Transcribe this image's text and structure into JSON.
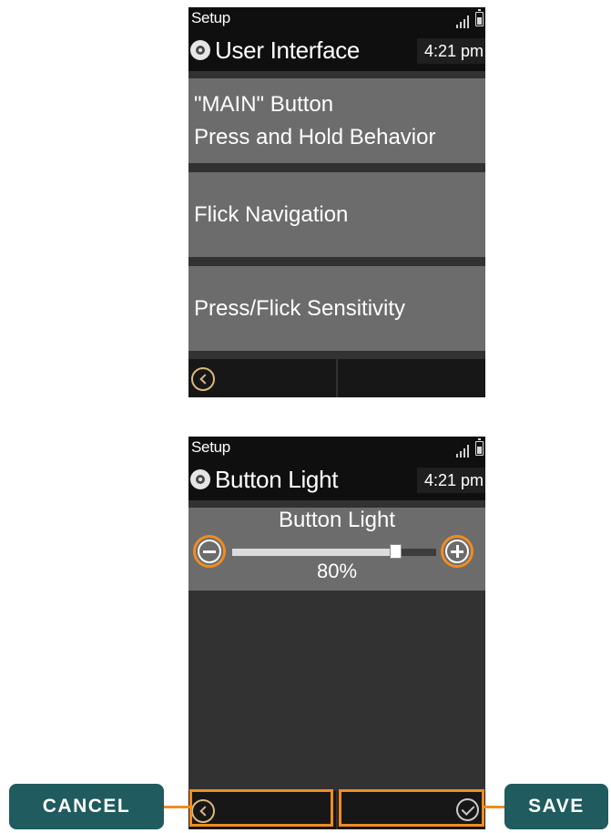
{
  "accent_color": "#f08c22",
  "callout_color": "#1f5b5f",
  "screen1": {
    "status": {
      "title": "Setup"
    },
    "titlebar": {
      "icon": "settings-gear-icon",
      "title": "User Interface",
      "time": "4:21 pm"
    },
    "menu": [
      {
        "line1": "\"MAIN\" Button",
        "line2": "Press and Hold Behavior"
      },
      {
        "line1": "Flick Navigation"
      },
      {
        "line1": "Press/Flick Sensitivity"
      }
    ],
    "bottom": {
      "back_icon": "back-chevron-icon"
    }
  },
  "screen2": {
    "status": {
      "title": "Setup"
    },
    "titlebar": {
      "icon": "settings-gear-icon",
      "title": "Button Light",
      "time": "4:21 pm"
    },
    "slider": {
      "label": "Button Light",
      "value_text": "80%",
      "value_fraction": 0.8,
      "minus_icon": "minus-icon",
      "plus_icon": "plus-icon"
    },
    "bottom": {
      "back_icon": "back-chevron-icon",
      "save_icon": "checkmark-icon"
    }
  },
  "callouts": {
    "cancel": "CANCEL",
    "save": "SAVE"
  }
}
